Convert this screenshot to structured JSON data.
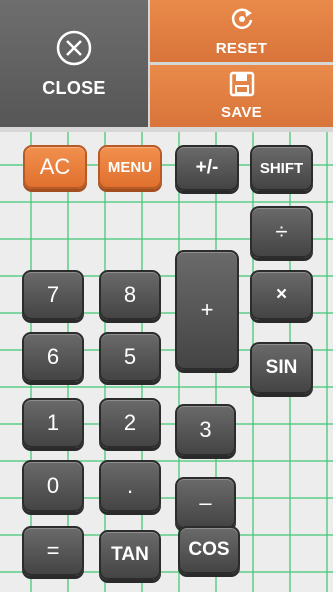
{
  "top": {
    "close_label": "CLOSE",
    "reset_label": "RESET",
    "save_label": "SAVE"
  },
  "keys": {
    "ac": "AC",
    "menu": "MENU",
    "plus_minus": "+/-",
    "shift": "SHIFT",
    "divide": "÷",
    "seven": "7",
    "eight": "8",
    "plus": "+",
    "multiply": "×",
    "six": "6",
    "five": "5",
    "sin": "SIN",
    "one": "1",
    "two": "2",
    "three": "3",
    "zero": "0",
    "dot": ".",
    "minus": "–",
    "equals": "=",
    "tan": "TAN",
    "cos": "COS"
  },
  "colors": {
    "accent": "#e07a3c",
    "dark_key": "#555555",
    "grid": "#5fcf8a"
  },
  "icons": {
    "close": "close-circle-icon",
    "reset": "reset-icon",
    "save": "floppy-disk-icon"
  }
}
